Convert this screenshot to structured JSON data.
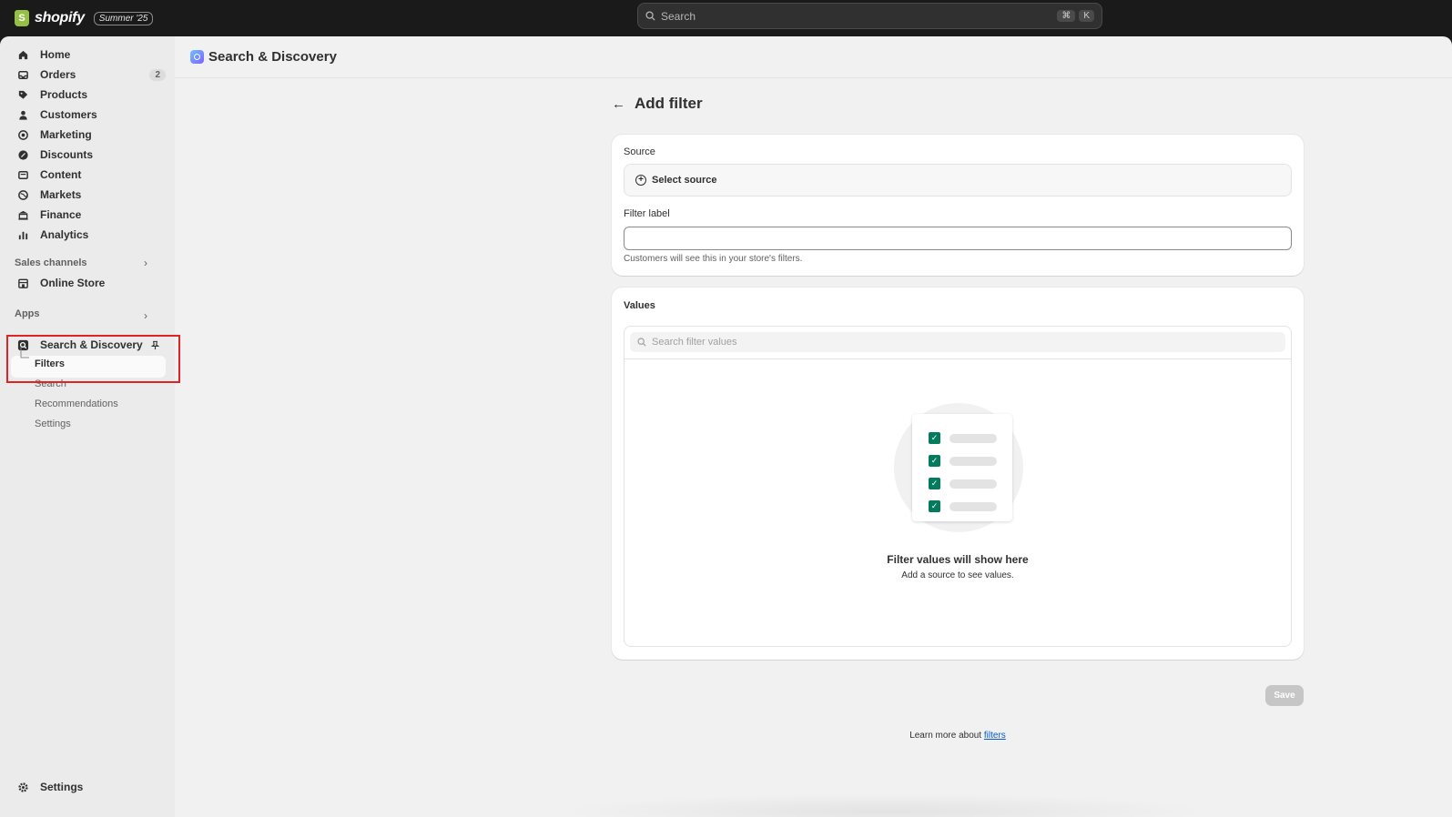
{
  "topbar": {
    "brand": "shopify",
    "edition": "Summer '25",
    "search_placeholder": "Search",
    "shortcut_keys": [
      "⌘",
      "K"
    ]
  },
  "sidebar": {
    "items": [
      {
        "label": "Home",
        "icon": "home-icon"
      },
      {
        "label": "Orders",
        "icon": "inbox-icon",
        "badge": "2"
      },
      {
        "label": "Products",
        "icon": "tag-icon"
      },
      {
        "label": "Customers",
        "icon": "person-icon"
      },
      {
        "label": "Marketing",
        "icon": "target-icon"
      },
      {
        "label": "Discounts",
        "icon": "discount-icon"
      },
      {
        "label": "Content",
        "icon": "content-icon"
      },
      {
        "label": "Markets",
        "icon": "globe-icon"
      },
      {
        "label": "Finance",
        "icon": "bank-icon"
      },
      {
        "label": "Analytics",
        "icon": "bar-chart-icon"
      }
    ],
    "sales_channels_label": "Sales channels",
    "online_store_label": "Online Store",
    "apps_label": "Apps",
    "app_name": "Search & Discovery",
    "app_subitems": [
      "Filters",
      "Search",
      "Recommendations",
      "Settings"
    ],
    "settings_label": "Settings"
  },
  "header": {
    "app_title": "Search & Discovery"
  },
  "page": {
    "title": "Add filter",
    "source_label": "Source",
    "select_source": "Select source",
    "filter_label_label": "Filter label",
    "filter_label_value": "",
    "filter_label_help": "Customers will see this in your store's filters.",
    "values_title": "Values",
    "values_search_placeholder": "Search filter values",
    "empty_title": "Filter values will show here",
    "empty_subtitle": "Add a source to see values.",
    "save_label": "Save",
    "learn_more_prefix": "Learn more about ",
    "learn_more_link": "filters"
  },
  "colors": {
    "accent_green": "#047b5d",
    "highlight_red": "#e02424",
    "link_blue": "#005bd3"
  }
}
